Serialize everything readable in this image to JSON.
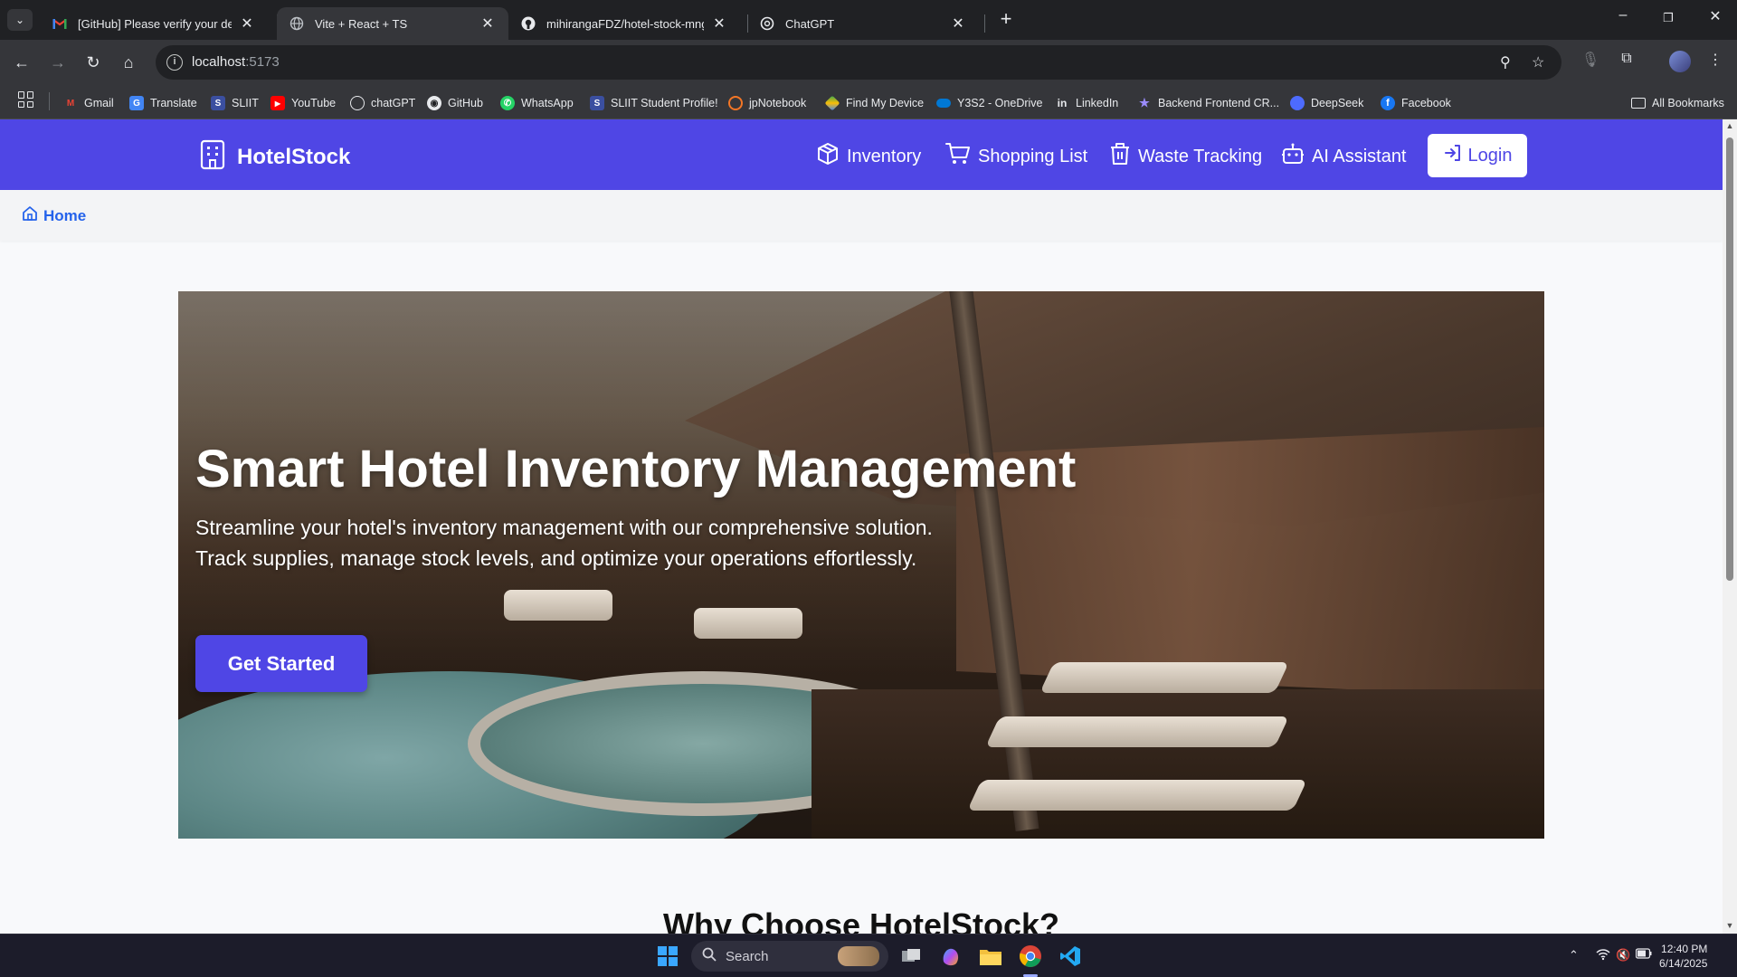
{
  "browser": {
    "tabs": [
      {
        "title": "[GitHub] Please verify your device",
        "favicon": "gmail-icon",
        "active": false
      },
      {
        "title": "Vite + React + TS",
        "favicon": "globe-icon",
        "active": true
      },
      {
        "title": "mihirangaFDZ/hotel-stock-mng-sy",
        "favicon": "github-icon",
        "active": false
      },
      {
        "title": "ChatGPT",
        "favicon": "chatgpt-icon",
        "active": false
      }
    ],
    "url_host": "localhost",
    "url_port": ":5173",
    "bookmarks": [
      {
        "label": "Gmail",
        "color": "#ea4335",
        "glyph": "M"
      },
      {
        "label": "Translate",
        "color": "#4285f4",
        "glyph": "G"
      },
      {
        "label": "SLIIT",
        "color": "#3b4fa0",
        "glyph": "S"
      },
      {
        "label": "YouTube",
        "color": "#ff0000",
        "glyph": "▶"
      },
      {
        "label": "chatGPT",
        "color": "#202124",
        "glyph": "✺"
      },
      {
        "label": "GitHub",
        "color": "#202124",
        "glyph": "◉"
      },
      {
        "label": "WhatsApp",
        "color": "#25d366",
        "glyph": "✆"
      },
      {
        "label": "SLIIT Student Profile!",
        "color": "#3b4fa0",
        "glyph": "S"
      },
      {
        "label": "jpNotebook",
        "color": "#f37626",
        "glyph": "◐"
      },
      {
        "label": "Find My Device",
        "color": "#34a853",
        "glyph": "◆"
      },
      {
        "label": "Y3S2 - OneDrive",
        "color": "#0078d4",
        "glyph": "☁"
      },
      {
        "label": "LinkedIn",
        "color": "#0a66c2",
        "glyph": "in"
      },
      {
        "label": "Backend Frontend CR...",
        "color": "#7b61ff",
        "glyph": "★"
      },
      {
        "label": "DeepSeek",
        "color": "#4d6bfe",
        "glyph": "◗"
      },
      {
        "label": "Facebook",
        "color": "#1877f2",
        "glyph": "f"
      }
    ],
    "all_bookmarks_label": "All Bookmarks"
  },
  "app": {
    "brand": "HotelStock",
    "nav": [
      {
        "label": "Inventory",
        "icon": "box-icon"
      },
      {
        "label": "Shopping List",
        "icon": "cart-icon"
      },
      {
        "label": "Waste Tracking",
        "icon": "trash-icon"
      },
      {
        "label": "AI Assistant",
        "icon": "bot-icon"
      }
    ],
    "login_label": "Login",
    "breadcrumb": "Home",
    "hero": {
      "title": "Smart Hotel Inventory Management",
      "subtitle": "Streamline your hotel's inventory management with our comprehensive solution. Track supplies, manage stock levels, and optimize your operations effortlessly.",
      "cta": "Get Started"
    },
    "section_title": "Why Choose HotelStock?",
    "accent_color": "#4f46e5"
  },
  "taskbar": {
    "search_label": "Search",
    "time": "12:40 PM",
    "date": "6/14/2025"
  }
}
